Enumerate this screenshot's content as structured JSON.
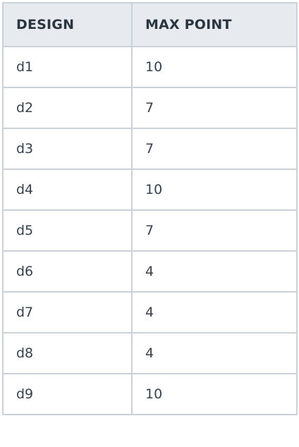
{
  "table": {
    "headers": [
      "DESIGN",
      "MAX POINT"
    ],
    "rows": [
      [
        "d1",
        "10"
      ],
      [
        "d2",
        "7"
      ],
      [
        "d3",
        "7"
      ],
      [
        "d4",
        "10"
      ],
      [
        "d5",
        "7"
      ],
      [
        "d6",
        "4"
      ],
      [
        "d7",
        "4"
      ],
      [
        "d8",
        "4"
      ],
      [
        "d9",
        "10"
      ]
    ]
  }
}
